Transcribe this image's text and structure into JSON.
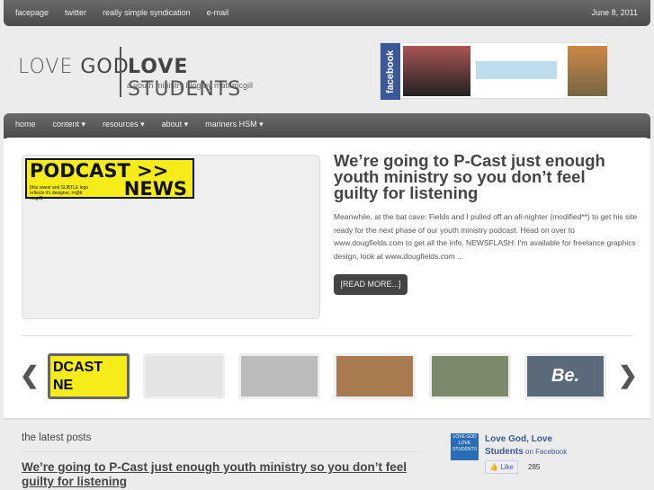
{
  "topbar": {
    "links": [
      "facepage",
      "twitter",
      "really simple syndication",
      "e-mail"
    ],
    "date": "June 8, 2011"
  },
  "header": {
    "logo_love1": "LOVE ",
    "logo_god": "GOD",
    "logo_love2": "LOVE",
    "logo_students": " STUDENTS",
    "tagline": "a youth ministry blog by matt mcgill",
    "facebook_label": "facebook"
  },
  "nav": {
    "items": [
      "home",
      "content ▾",
      "resources ▾",
      "about ▾",
      "mariners HSM ▾"
    ]
  },
  "featured": {
    "image_line1": "PODCAST >>",
    "image_line2": "NEWS",
    "image_caption": "[this sweet and SUBTLE logo reflects it's designer, m@tt mcgill]",
    "title": "We’re going to P-Cast just enough youth ministry so you don’t feel guilty for listening",
    "body": "Meanwhile, at the bat cave: Fields and I pulled off an all-nighter (modified**) to get his site ready for the next phase of our youth ministry podcast. Head on over to www.dougfields.com to get all the info. NEWSFLASH: I'm available for freelance graphics design, look at www.dougfields.com ...",
    "read_more": "[READ MORE...]"
  },
  "carousel": {
    "prev": "❮",
    "next": "❯",
    "thumb_texts": [
      "DCAST NE",
      "",
      "",
      "",
      "",
      "Be."
    ]
  },
  "latest": {
    "heading": "the latest posts",
    "post_title": "We’re going to P-Cast just enough youth ministry so you don’t feel guilty for listening"
  },
  "fb_widget": {
    "logo_text": "LOVE GOD LOVE STUDENTS",
    "name": "Love God, Love Students",
    "suffix": " on Facebook",
    "like": "👍 Like",
    "count": "285"
  }
}
